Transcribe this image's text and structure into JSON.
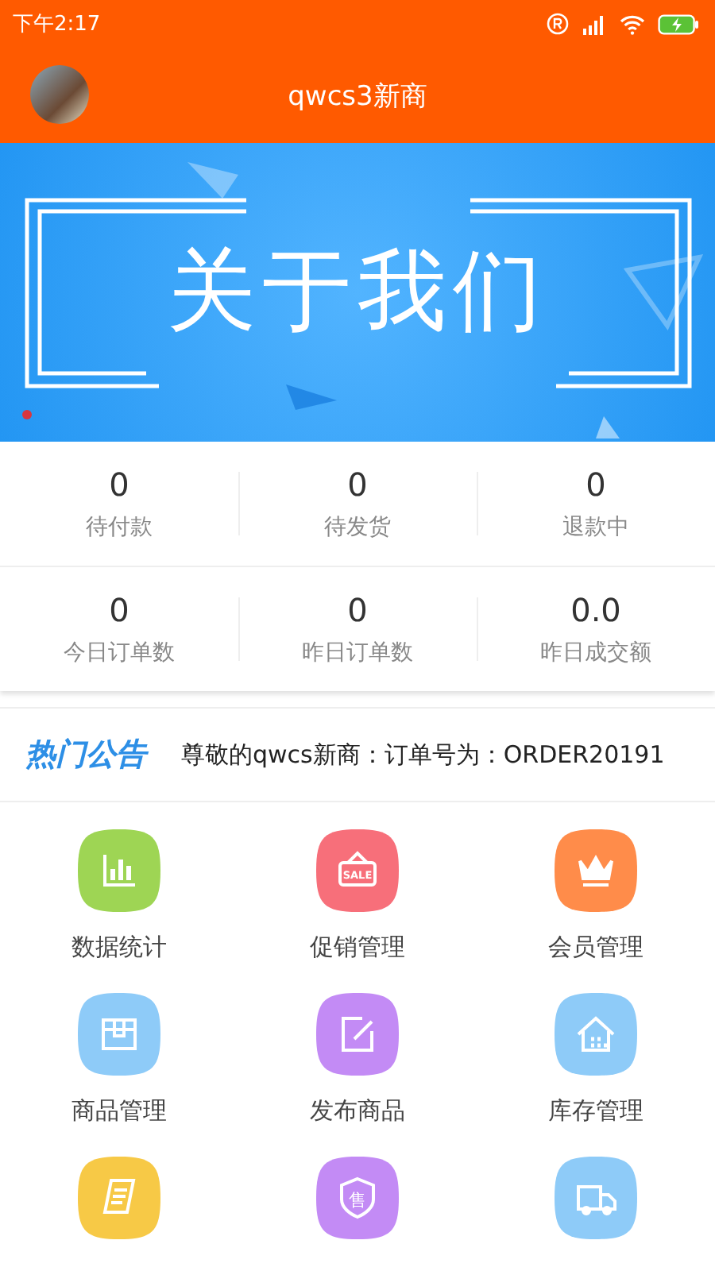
{
  "status_bar": {
    "time": "下午2:17"
  },
  "header": {
    "title": "qwcs3新商"
  },
  "banner": {
    "title": "关于我们"
  },
  "stats": [
    {
      "value": "0",
      "label": "待付款"
    },
    {
      "value": "0",
      "label": "待发货"
    },
    {
      "value": "0",
      "label": "退款中"
    },
    {
      "value": "0",
      "label": "今日订单数"
    },
    {
      "value": "0",
      "label": "昨日订单数"
    },
    {
      "value": "0.0",
      "label": "昨日成交额"
    }
  ],
  "notice": {
    "heading": "热门公告",
    "text": "尊敬的qwcs新商：订单号为：ORDER20191"
  },
  "menu": [
    {
      "kind": "chart",
      "color": "#9ed554",
      "label": "数据统计"
    },
    {
      "kind": "sale",
      "color": "#f76f7a",
      "label": "促销管理",
      "glyph": "SALE"
    },
    {
      "kind": "crown",
      "color": "#ff8c4a",
      "label": "会员管理"
    },
    {
      "kind": "box",
      "color": "#8ecbf8",
      "label": "商品管理"
    },
    {
      "kind": "edit",
      "color": "#c38bf5",
      "label": "发布商品"
    },
    {
      "kind": "warehouse",
      "color": "#8ecbf8",
      "label": "库存管理"
    },
    {
      "kind": "receipt",
      "color": "#f7c946"
    },
    {
      "kind": "shield",
      "color": "#c38bf5",
      "glyph": "售"
    },
    {
      "kind": "truck",
      "color": "#8ecbf8"
    }
  ]
}
